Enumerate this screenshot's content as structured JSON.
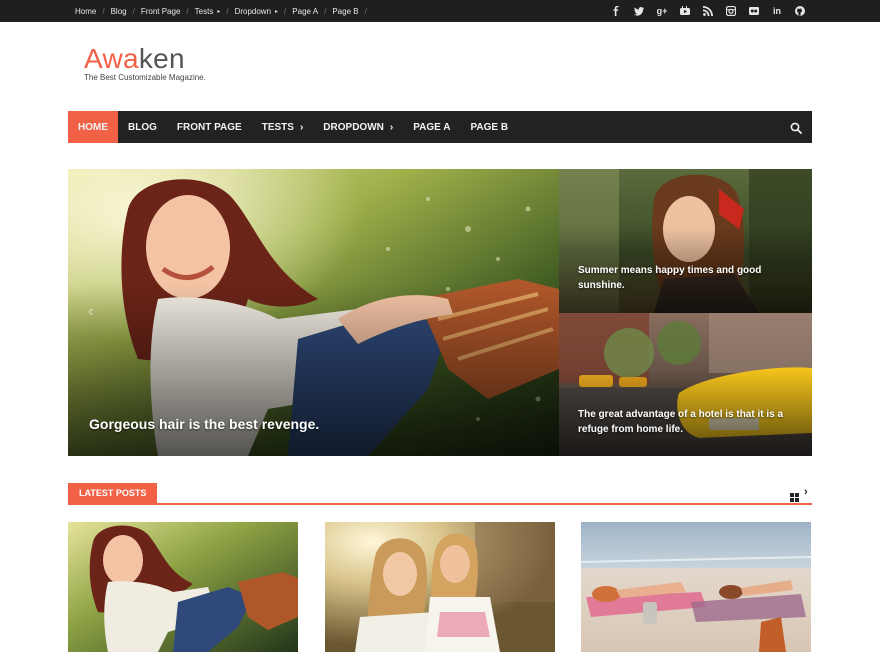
{
  "topbar": {
    "links": [
      {
        "label": "Home",
        "caret": false
      },
      {
        "label": "Blog",
        "caret": false
      },
      {
        "label": "Front Page",
        "caret": false
      },
      {
        "label": "Tests",
        "caret": true
      },
      {
        "label": "Dropdown",
        "caret": true
      },
      {
        "label": "Page A",
        "caret": false
      },
      {
        "label": "Page B",
        "caret": false
      }
    ],
    "social_icons": [
      "facebook-icon",
      "twitter-icon",
      "google-plus-icon",
      "youtube-icon",
      "rss-icon",
      "instagram-icon",
      "flickr-icon",
      "linkedin-icon",
      "github-icon"
    ]
  },
  "site": {
    "title_accent": "Awa",
    "title_rest": "ken",
    "tagline": "The Best Customizable Magazine."
  },
  "nav": {
    "items": [
      {
        "label": "HOME",
        "active": true
      },
      {
        "label": "BLOG"
      },
      {
        "label": "FRONT PAGE"
      },
      {
        "label": "TESTS",
        "dropdown": true
      },
      {
        "label": "DROPDOWN",
        "dropdown": true
      },
      {
        "label": "PAGE A"
      },
      {
        "label": "PAGE B"
      }
    ],
    "search_icon": "search-icon"
  },
  "slider": {
    "main_caption": "Gorgeous hair is the best revenge.",
    "side": [
      {
        "caption": "Summer means happy times and good sunshine."
      },
      {
        "caption": "The great advantage of a hotel is that it is a refuge from home life."
      }
    ]
  },
  "latest": {
    "title": "LATEST POSTS",
    "grid_icon": "grid-icon",
    "next_icon": "chevron-right-icon"
  },
  "colors": {
    "accent": "#f26146",
    "topbar": "#1f1f1f",
    "nav": "#222222"
  }
}
